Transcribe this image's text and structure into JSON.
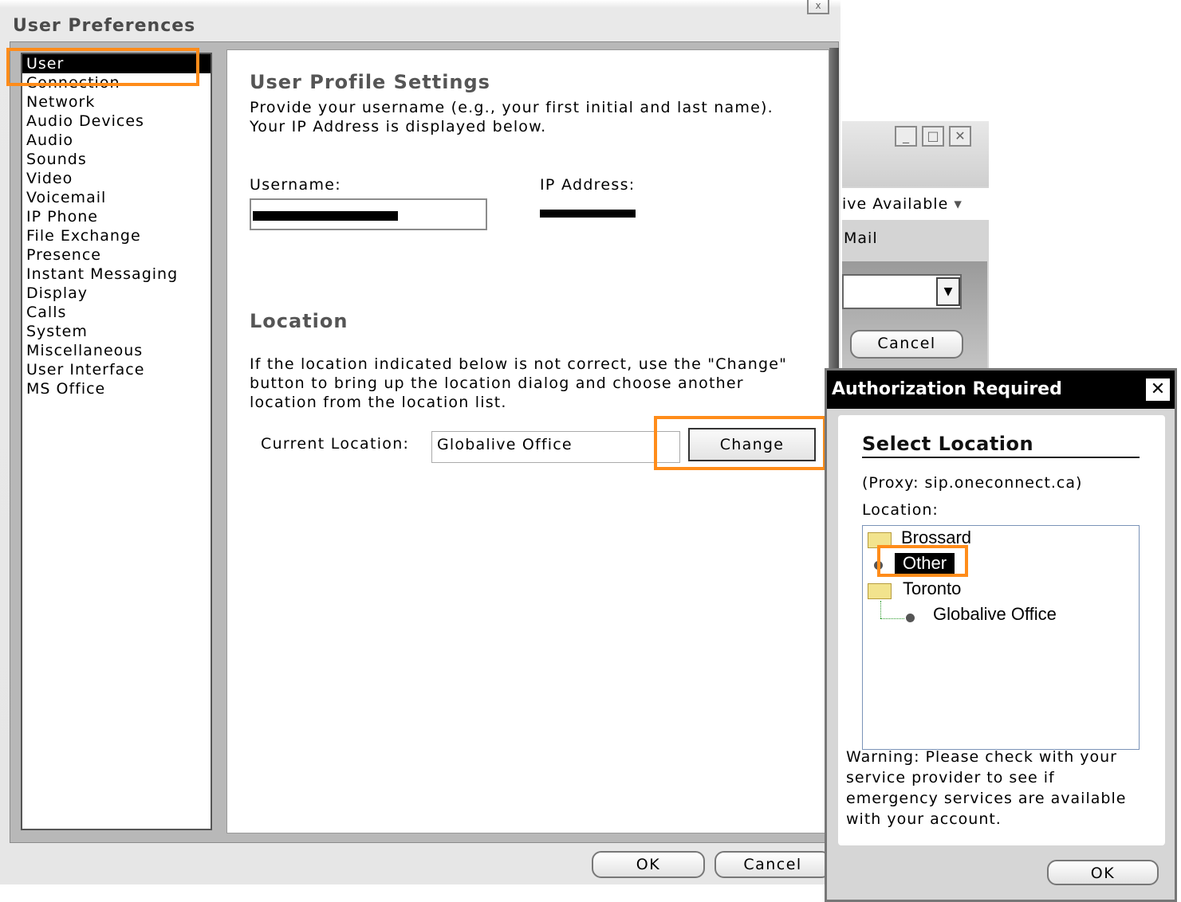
{
  "main_window": {
    "title": "User Preferences",
    "close_glyph": "x",
    "nav": {
      "items": [
        {
          "label": "User",
          "selected": true
        },
        {
          "label": "Connection",
          "selected": false
        },
        {
          "label": "Network",
          "selected": false
        },
        {
          "label": "Audio Devices",
          "selected": false
        },
        {
          "label": "Audio",
          "selected": false
        },
        {
          "label": "Sounds",
          "selected": false
        },
        {
          "label": "Video",
          "selected": false
        },
        {
          "label": "Voicemail",
          "selected": false
        },
        {
          "label": "IP Phone",
          "selected": false
        },
        {
          "label": "File Exchange",
          "selected": false
        },
        {
          "label": "Presence",
          "selected": false
        },
        {
          "label": "Instant Messaging",
          "selected": false
        },
        {
          "label": "Display",
          "selected": false
        },
        {
          "label": "Calls",
          "selected": false
        },
        {
          "label": "System",
          "selected": false
        },
        {
          "label": "Miscellaneous",
          "selected": false
        },
        {
          "label": "User Interface",
          "selected": false
        },
        {
          "label": "MS Office",
          "selected": false
        }
      ]
    },
    "profile": {
      "heading": "User Profile Settings",
      "description": "Provide your username (e.g., your first initial and last name).\nYour IP Address is displayed below.",
      "username_label": "Username:",
      "username_value": "",
      "ip_label": "IP Address:",
      "ip_value": ""
    },
    "location": {
      "heading": "Location",
      "description": "If the location indicated below is not correct, use the \"Change\"\nbutton to bring up the location dialog and choose another\nlocation from the location list.",
      "current_label": "Current Location:",
      "current_value": "Globalive Office",
      "change_button": "Change"
    },
    "footer": {
      "ok_label": "OK",
      "cancel_label": "Cancel"
    }
  },
  "background_window": {
    "minimize_glyph": "_",
    "maximize_glyph": "□",
    "close_glyph": "✕",
    "status_text": "ive Available",
    "status_caret": "▾",
    "mail_text": "Mail",
    "dropdown_glyph": "▼",
    "cancel_label": "Cancel"
  },
  "auth_dialog": {
    "title": "Authorization Required",
    "close_glyph": "✕",
    "heading": "Select Location",
    "proxy_text": "(Proxy: sip.oneconnect.ca)",
    "location_label": "Location:",
    "tree": [
      {
        "label": "Brossard",
        "type": "folder"
      },
      {
        "label": "Other",
        "type": "leaf",
        "selected": true
      },
      {
        "label": "Toronto",
        "type": "folder"
      },
      {
        "label": "Globalive Office",
        "type": "leaf",
        "selected": false
      }
    ],
    "warning": "Warning: Please check with your\nservice provider to see if\nemergency services are available\nwith your account.",
    "ok_label": "OK"
  },
  "colors": {
    "highlight": "#ff8c1a",
    "selection": "#000000",
    "titlebar": "#000000"
  }
}
